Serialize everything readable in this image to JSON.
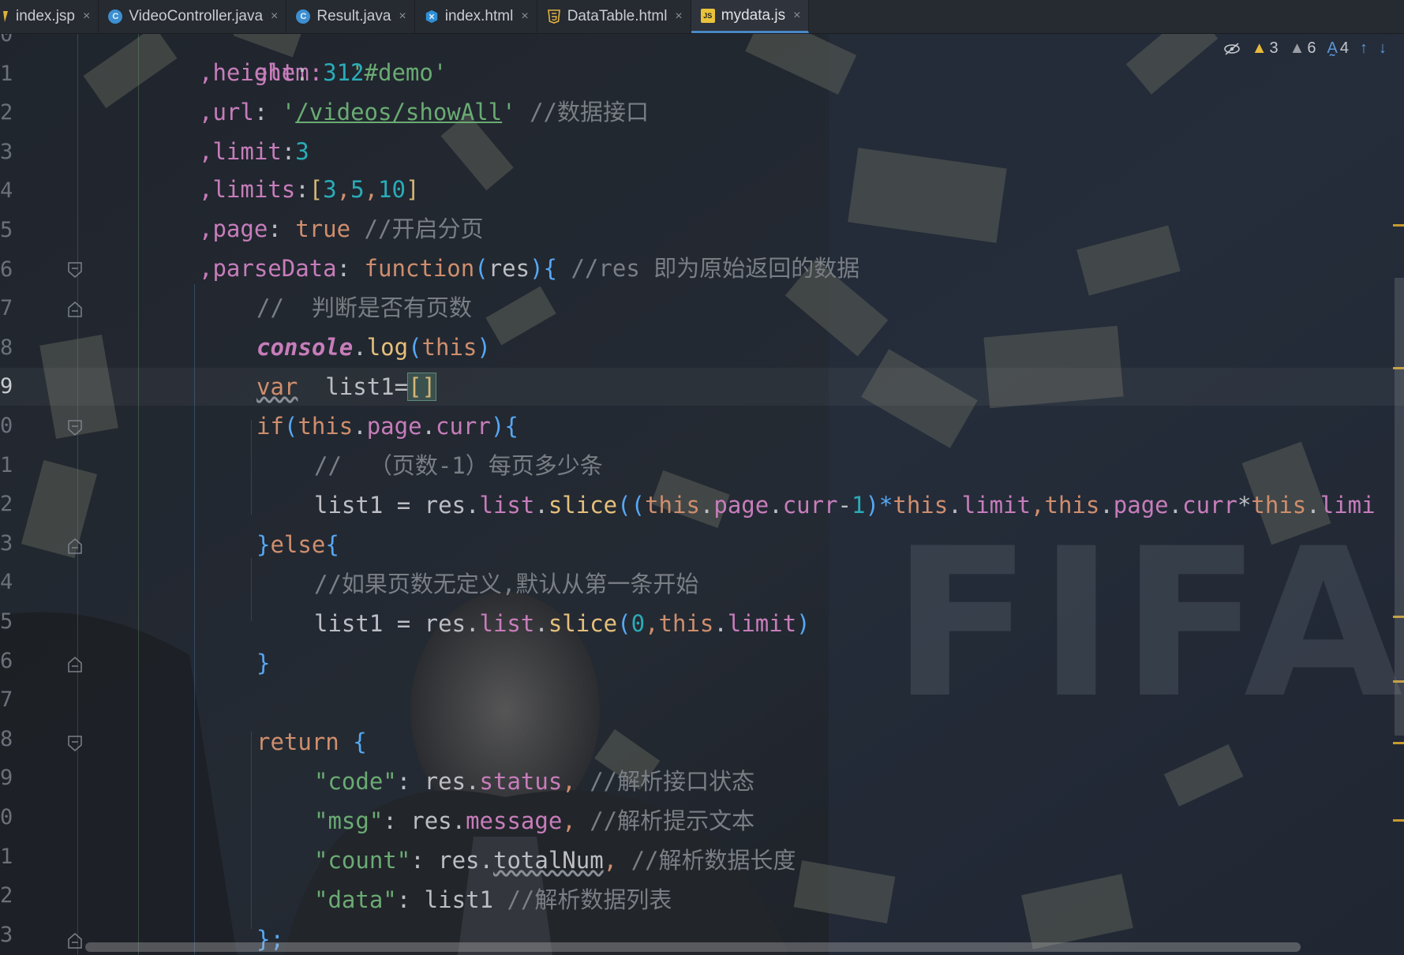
{
  "tabs": [
    {
      "label": "index.jsp",
      "icon": "jsp-file-icon",
      "active": false
    },
    {
      "label": "VideoController.java",
      "icon": "java-class-icon",
      "active": false
    },
    {
      "label": "Result.java",
      "icon": "java-class-icon",
      "active": false
    },
    {
      "label": "index.html",
      "icon": "vue-html-icon",
      "active": false
    },
    {
      "label": "DataTable.html",
      "icon": "html5-file-icon",
      "active": false
    },
    {
      "label": "mydata.js",
      "icon": "js-file-icon",
      "active": true
    }
  ],
  "close_glyph": "×",
  "inspections": {
    "errors_count": "3",
    "warnings_count": "6",
    "typos_count": "4"
  },
  "gutter_numbers": [
    "0",
    "1",
    "2",
    "3",
    "4",
    "5",
    "6",
    "7",
    "8",
    "9",
    "0",
    "1",
    "2",
    "3",
    "4",
    "5",
    "6",
    "7",
    "8",
    "9",
    "0",
    "1",
    "2",
    "3"
  ],
  "current_line_index": 9,
  "code": {
    "l0": [
      "elem:",
      "'#demo'"
    ],
    "l1": [
      ",height",
      ": ",
      "312"
    ],
    "l2": [
      ",url",
      ": ",
      "'",
      "/videos/showAll",
      "'",
      " //数据接口"
    ],
    "l3": [
      ",limit",
      ":",
      "3"
    ],
    "l4": [
      ",limits",
      ":",
      "[",
      "3",
      ",",
      "5",
      ",",
      "10",
      "]"
    ],
    "l5": [
      ",page",
      ": ",
      "true",
      " //开启分页"
    ],
    "l6": [
      ",parseData",
      ": ",
      "function",
      "(",
      "res",
      ")",
      "{",
      " //res 即为原始返回的数据"
    ],
    "l7": [
      "//  判断是否有页数"
    ],
    "l8": [
      "console",
      ".",
      "log",
      "(",
      "this",
      ")"
    ],
    "l9": [
      "var",
      "  list1=",
      "[]"
    ],
    "l10": [
      "if",
      "(",
      "this",
      ".",
      "page",
      ".",
      "curr",
      ")",
      "{"
    ],
    "l11": [
      "//  （页数-1）每页多少条"
    ],
    "l12": [
      "list1 = res.",
      "list",
      ".",
      "slice",
      "((",
      "this",
      ".",
      "page",
      ".",
      "curr",
      "-",
      "1",
      ")*",
      "this",
      ".",
      "limit",
      ",",
      "this",
      ".",
      "page",
      ".",
      "curr",
      "*",
      "this",
      ".",
      "limi"
    ],
    "l13": [
      "}",
      "else",
      "{"
    ],
    "l14": [
      "//如果页数无定义,默认从第一条开始"
    ],
    "l15": [
      "list1 = res.",
      "list",
      ".",
      "slice",
      "(",
      "0",
      ",",
      "this",
      ".",
      "limit",
      ")"
    ],
    "l16": [
      "}"
    ],
    "l18": [
      "return",
      " {"
    ],
    "l19": [
      "\"code\"",
      ": res.",
      "status",
      ",",
      " //解析接口状态"
    ],
    "l20": [
      "\"msg\"",
      ": res.",
      "message",
      ",",
      " //解析提示文本"
    ],
    "l21": [
      "\"count\"",
      ": res.",
      "totalNum",
      ",",
      " //解析数据长度"
    ],
    "l22": [
      "\"data\"",
      ": list1",
      " //解析数据列表"
    ],
    "l23": [
      "};"
    ]
  },
  "background_text": "FIFA",
  "colors": {
    "keyword": "#cf8e6d",
    "property": "#c77dbb",
    "number": "#2aacb8",
    "string": "#6aab73",
    "comment": "#7a7e85",
    "function": "#56a8f5",
    "active_tab_border": "#4a88c7"
  }
}
